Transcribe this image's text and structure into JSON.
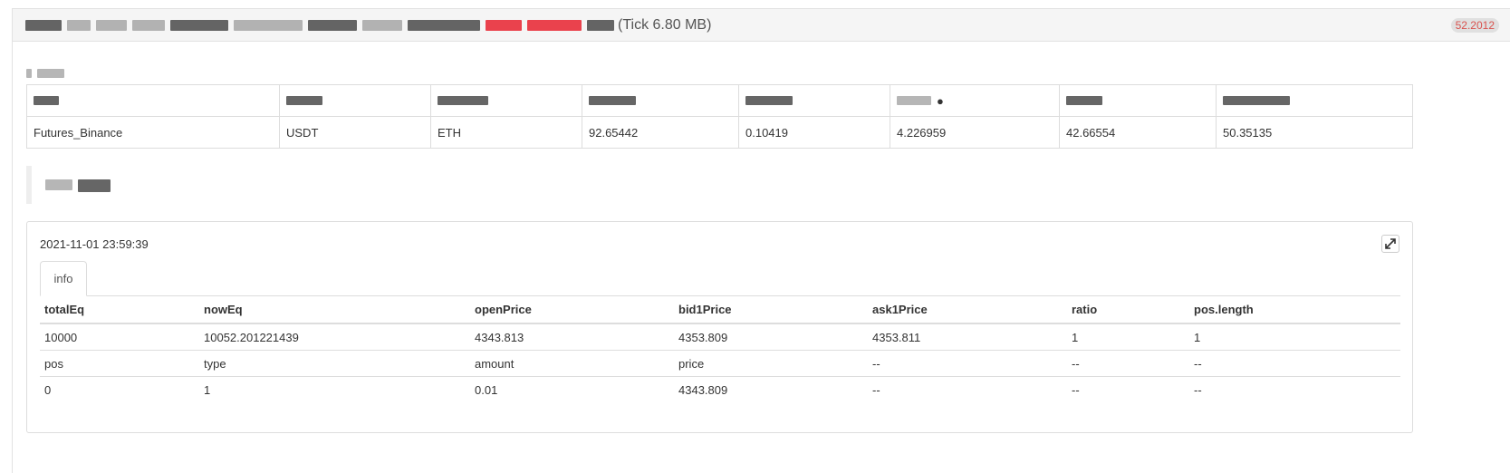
{
  "header": {
    "title_suffix": "(Tick 6.80 MB)",
    "badge": "52.2012"
  },
  "account_table": {
    "row": [
      "Futures_Binance",
      "USDT",
      "ETH",
      "92.65442",
      "0.10419",
      "4.226959",
      "42.66554",
      "50.35135"
    ]
  },
  "panel": {
    "timestamp": "2021-11-01 23:59:39",
    "expand_icon": "expand-icon",
    "tab_label": "info",
    "columns": [
      "totalEq",
      "nowEq",
      "openPrice",
      "bid1Price",
      "ask1Price",
      "ratio",
      "pos.length"
    ],
    "rows": [
      [
        "10000",
        "10052.201221439",
        "4343.813",
        "4353.809",
        "4353.811",
        "1",
        "1"
      ],
      [
        "pos",
        "type",
        "amount",
        "price",
        "--",
        "--",
        "--"
      ],
      [
        "0",
        "1",
        "0.01",
        "4343.809",
        "--",
        "--",
        "--"
      ]
    ]
  },
  "colors": {
    "badge_text": "#d9534f",
    "header_bg": "#f5f5f5",
    "border": "#dddddd"
  }
}
